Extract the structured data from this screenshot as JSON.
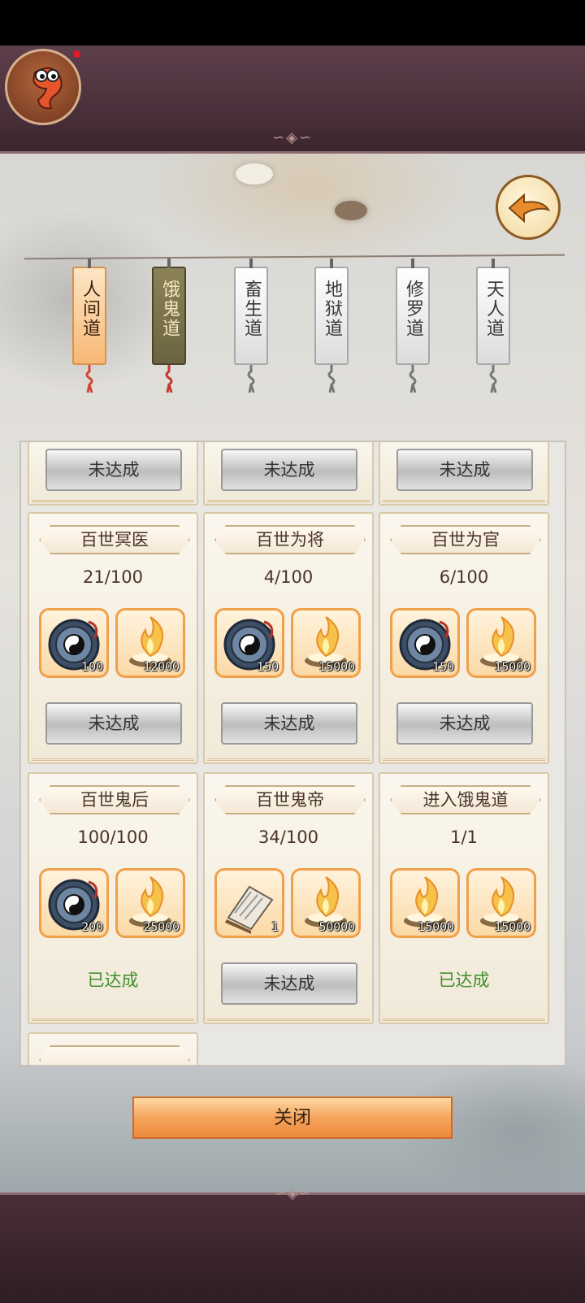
{
  "tabs": [
    {
      "label": "人间道",
      "state": "active"
    },
    {
      "label": "饿鬼道",
      "state": "selected"
    },
    {
      "label": "畜生道",
      "state": "normal"
    },
    {
      "label": "地狱道",
      "state": "normal"
    },
    {
      "label": "修罗道",
      "state": "normal"
    },
    {
      "label": "天人道",
      "state": "normal"
    }
  ],
  "top_row_buttons": [
    "未达成",
    "未达成",
    "未达成"
  ],
  "cards": [
    {
      "title": "百世冥医",
      "progress": "21/100",
      "rewards": [
        {
          "icon": "bagua-compass-icon",
          "count": "100"
        },
        {
          "icon": "spirit-flame-icon",
          "count": "12000"
        }
      ],
      "status": "未达成",
      "achieved": false
    },
    {
      "title": "百世为将",
      "progress": "4/100",
      "rewards": [
        {
          "icon": "bagua-compass-icon",
          "count": "150"
        },
        {
          "icon": "spirit-flame-icon",
          "count": "15000"
        }
      ],
      "status": "未达成",
      "achieved": false
    },
    {
      "title": "百世为官",
      "progress": "6/100",
      "rewards": [
        {
          "icon": "bagua-compass-icon",
          "count": "150"
        },
        {
          "icon": "spirit-flame-icon",
          "count": "15000"
        }
      ],
      "status": "未达成",
      "achieved": false
    },
    {
      "title": "百世鬼后",
      "progress": "100/100",
      "rewards": [
        {
          "icon": "bagua-compass-icon",
          "count": "200"
        },
        {
          "icon": "spirit-flame-icon",
          "count": "25000"
        }
      ],
      "status": "已达成",
      "achieved": true
    },
    {
      "title": "百世鬼帝",
      "progress": "34/100",
      "rewards": [
        {
          "icon": "scroll-book-icon",
          "count": "1"
        },
        {
          "icon": "spirit-flame-icon",
          "count": "50000"
        }
      ],
      "status": "未达成",
      "achieved": false
    },
    {
      "title": "进入饿鬼道",
      "progress": "1/1",
      "rewards": [
        {
          "icon": "spirit-flame-icon",
          "count": "15000"
        },
        {
          "icon": "spirit-flame-icon",
          "count": "15000"
        }
      ],
      "status": "已达成",
      "achieved": true
    }
  ],
  "close_label": "关闭",
  "colors": {
    "achieved": "#3f8f2d",
    "accent": "#f5a45c"
  }
}
